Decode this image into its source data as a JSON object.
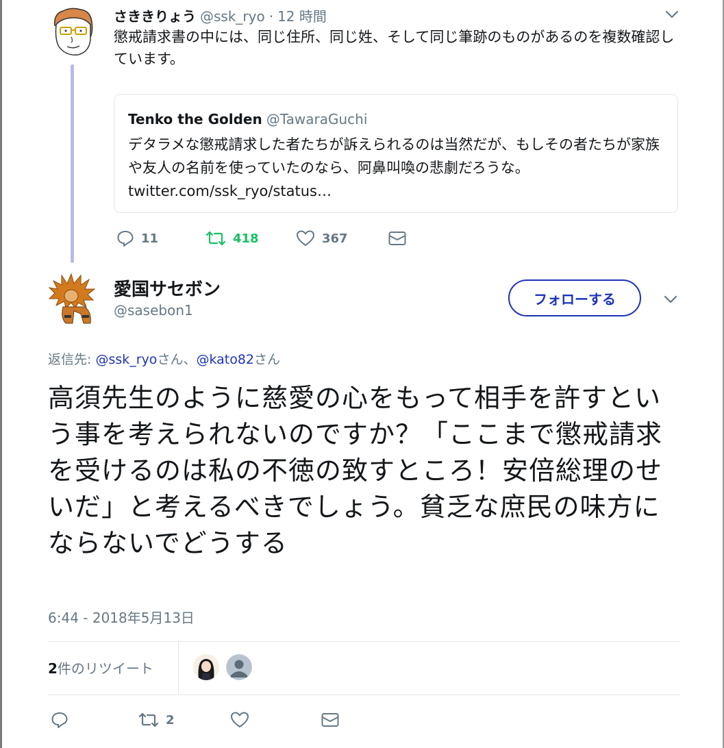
{
  "tweet1": {
    "name": "さききりょう",
    "handle": "@ssk_ryo",
    "dot": "·",
    "time": "12 時間",
    "text": "懲戒請求書の中には、同じ住所、同じ姓、そして同じ筆跡のものがあるのを複数確認しています。",
    "quote": {
      "name": "Tenko the Golden",
      "handle": "@TawaraGuchi",
      "text": "デタラメな懲戒請求した者たちが訴えられるのは当然だが、もしその者たちが家族や友人の名前を使っていたのなら、阿鼻叫喚の悲劇だろうな。",
      "link": "twitter.com/ssk_ryo/status…"
    },
    "actions": {
      "reply_count": "11",
      "retweet_count": "418",
      "like_count": "367"
    }
  },
  "tweet2": {
    "name": "愛国サセボン",
    "handle": "@sasebon1",
    "follow_label": "フォローする",
    "reply_prefix": "返信先: ",
    "reply_user1": "@ssk_ryo",
    "reply_san1": "さん、",
    "reply_user2": "@kato82",
    "reply_san2": "さん",
    "text": "高須先生のように慈愛の心をもって相手を許すという事を考えられないのですか？「ここまで懲戒請求を受けるのは私の不徳の致すところ！安倍総理のせいだ」と考えるべきでしょう。貧乏な庶民の味方にならないでどうする",
    "timestamp": "6:44 - 2018年5月13日",
    "retweets": {
      "count": "2",
      "label": "件のリツイート"
    },
    "actions": {
      "retweet_count": "2"
    }
  },
  "colors": {
    "link_blue": "#1d33b8",
    "retweet_green": "#17bf63",
    "muted_gray": "#657786",
    "thread_line": "#b9b9ea"
  }
}
